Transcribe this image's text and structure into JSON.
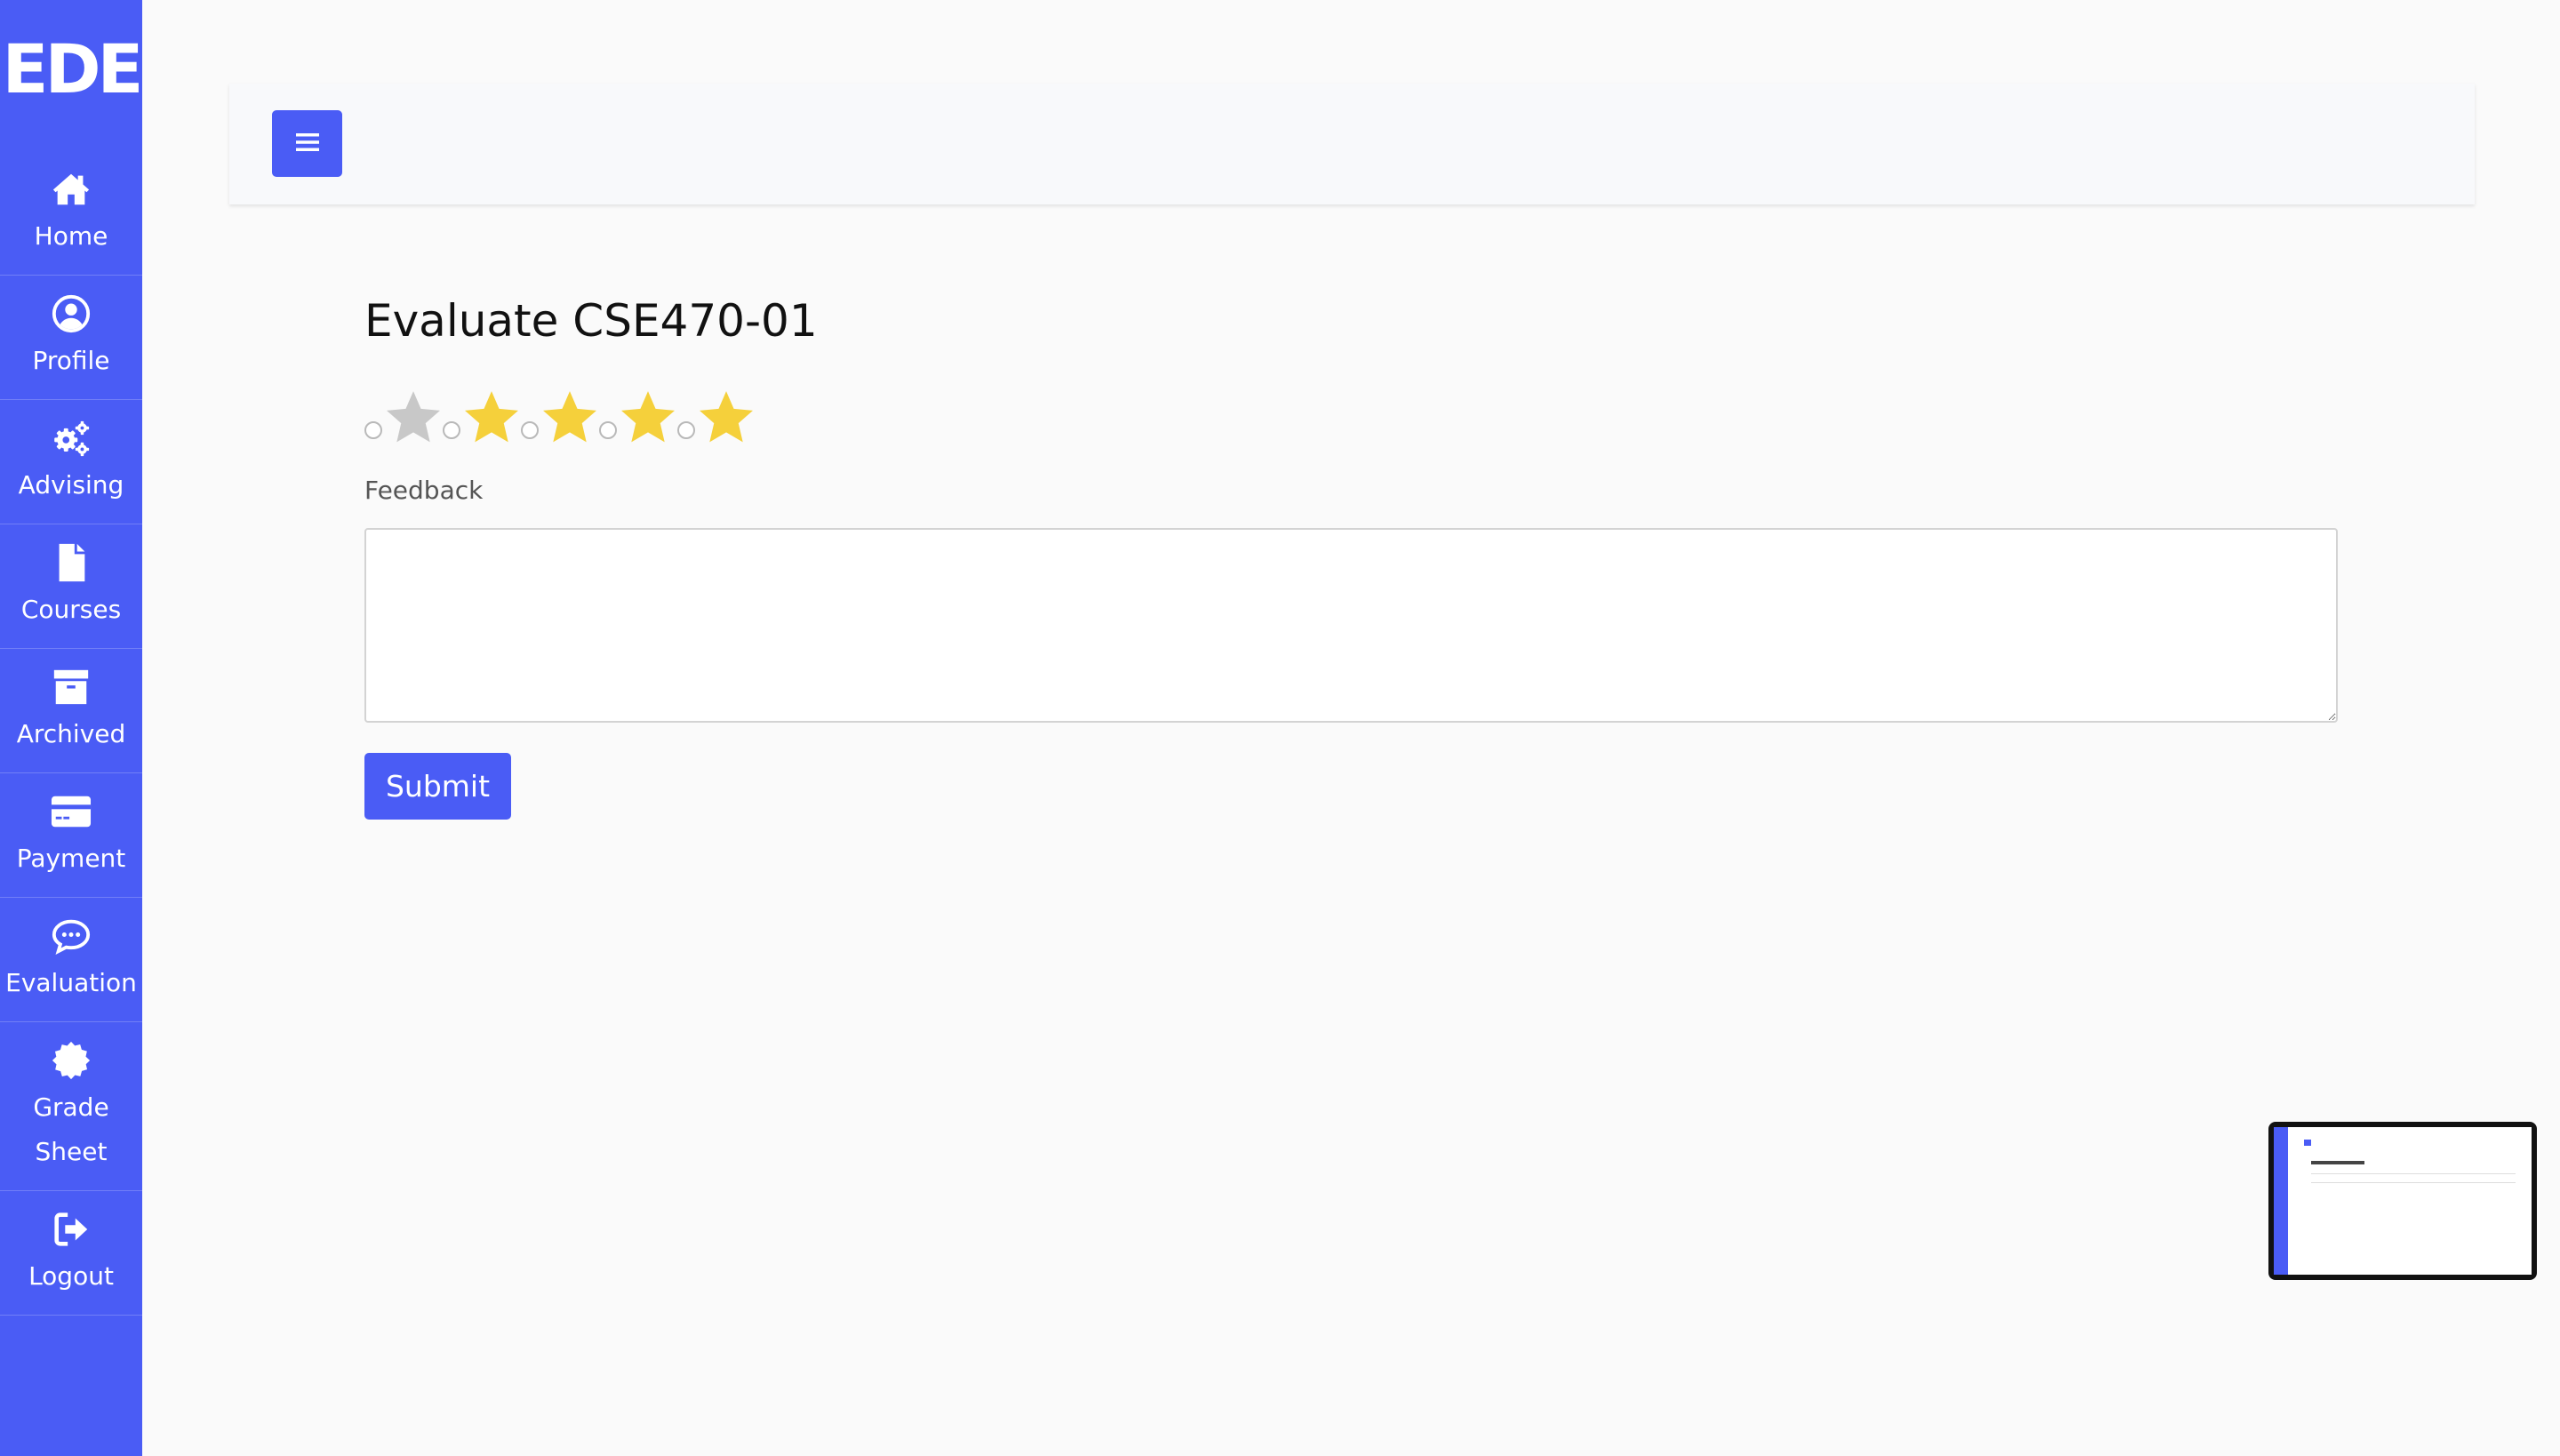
{
  "app": {
    "logo_text": "EDE",
    "brand_color": "#4a5cf5"
  },
  "sidebar": {
    "items": [
      {
        "label": "Home",
        "icon": "home-icon"
      },
      {
        "label": "Profile",
        "icon": "user-circle-icon"
      },
      {
        "label": "Advising",
        "icon": "gears-icon"
      },
      {
        "label": "Courses",
        "icon": "file-icon"
      },
      {
        "label": "Archived",
        "icon": "archive-box-icon"
      },
      {
        "label": "Payment",
        "icon": "credit-card-icon"
      },
      {
        "label": "Evaluation",
        "icon": "chat-bubble-icon"
      },
      {
        "label": "Grade Sheet",
        "icon": "certificate-icon"
      },
      {
        "label": "Logout",
        "icon": "logout-icon"
      }
    ]
  },
  "topbar": {
    "menu_icon": "hamburger-icon"
  },
  "page": {
    "title": "Evaluate CSE470-01"
  },
  "rating": {
    "star_colors": [
      "#c8c8c8",
      "#f5d03b",
      "#f5d03b",
      "#f5d03b",
      "#f5d03b"
    ],
    "stars_count": 5
  },
  "form": {
    "feedback_label": "Feedback",
    "feedback_value": "",
    "submit_label": "Submit"
  }
}
